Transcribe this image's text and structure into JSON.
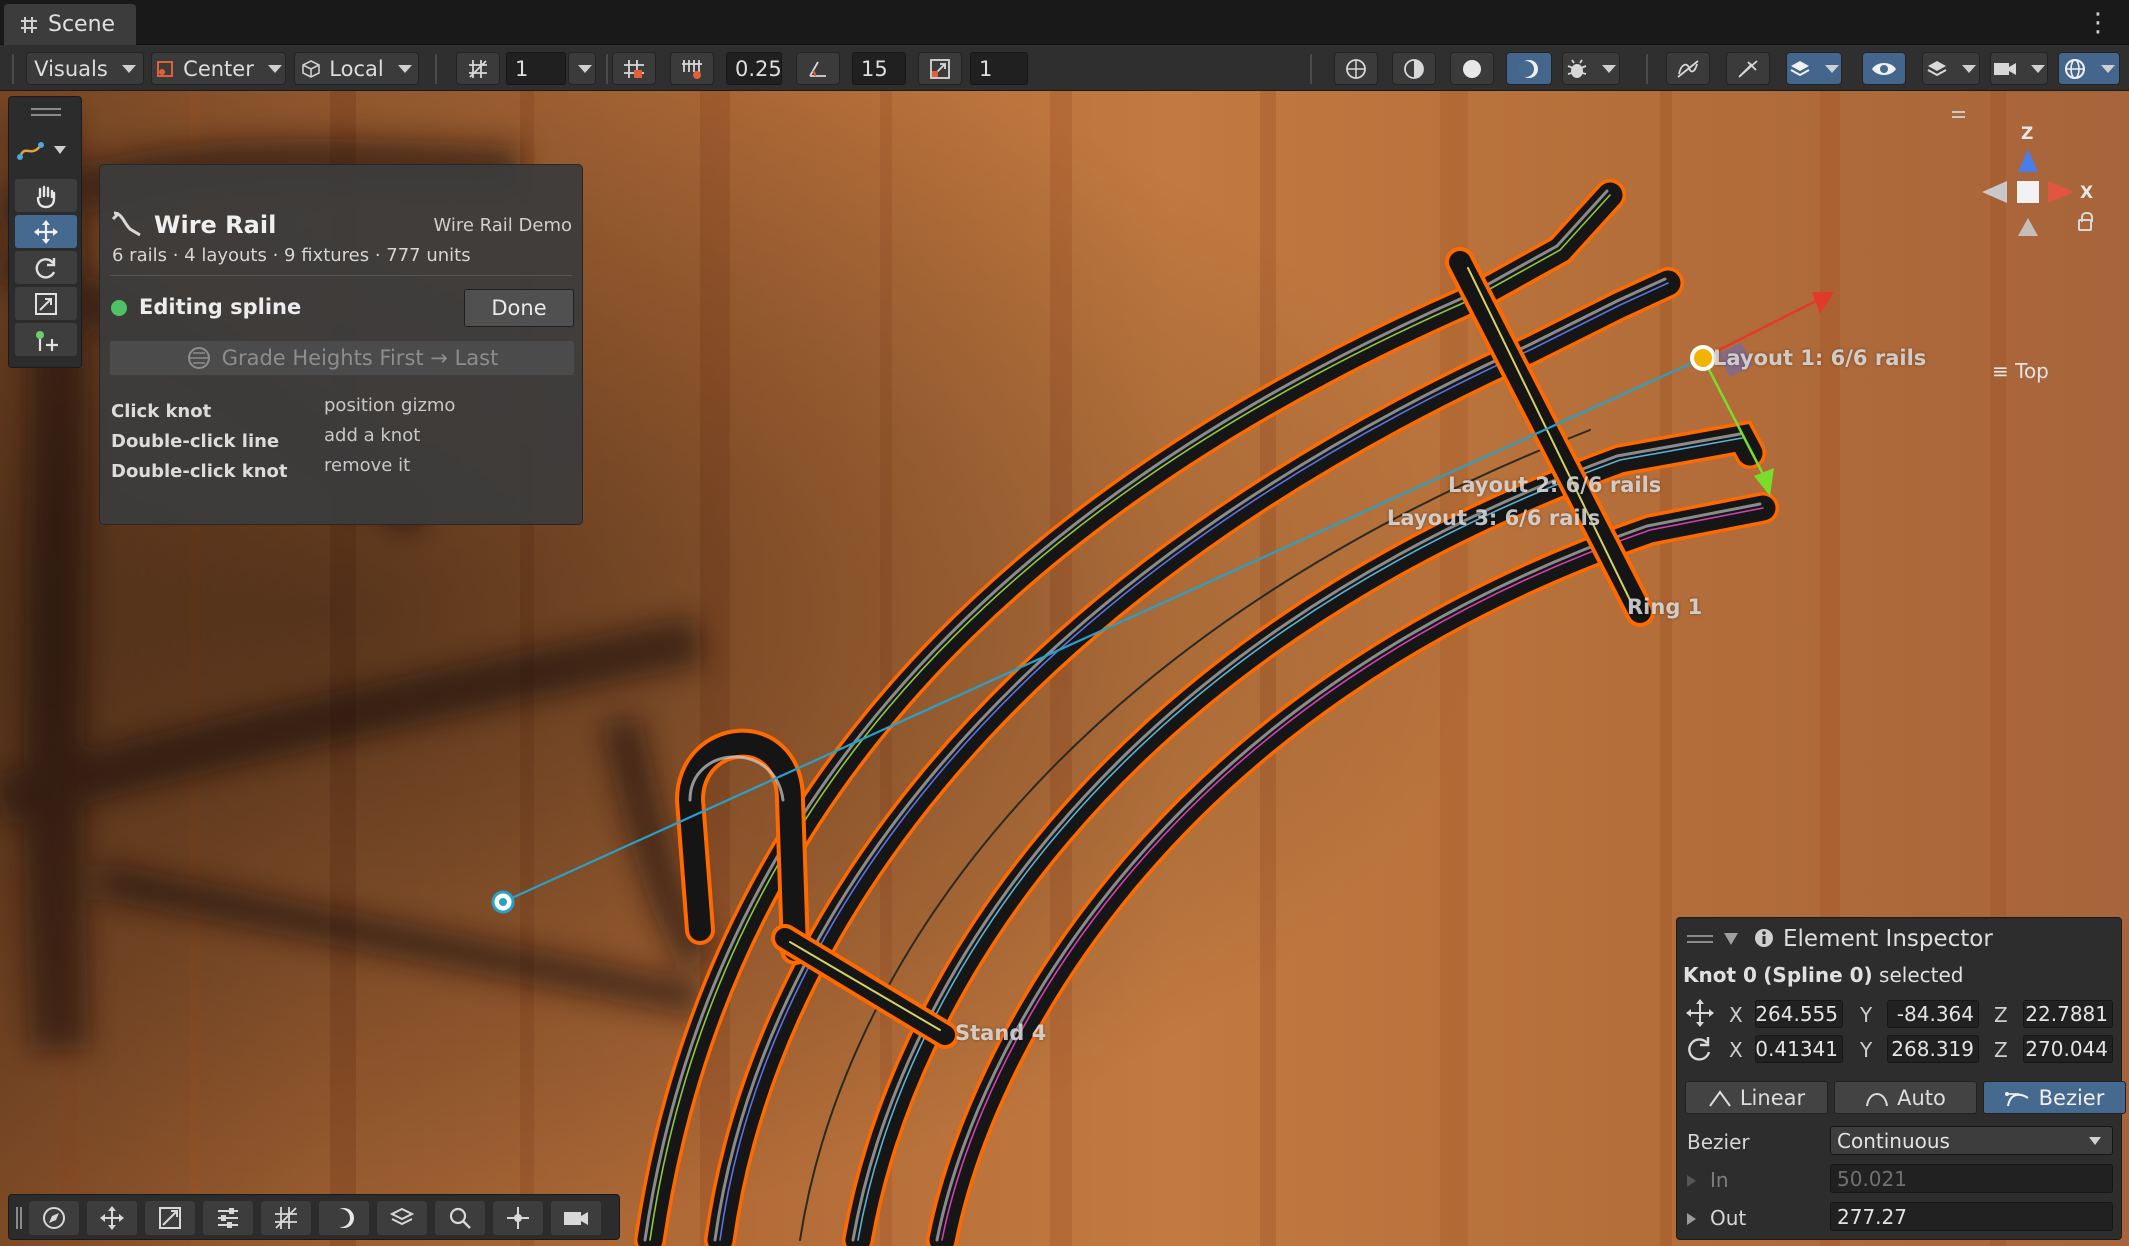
{
  "window": {
    "tab_title": "Scene",
    "menu_icon": "kebab-menu-icon"
  },
  "toolbar": {
    "visuals_label": "Visuals",
    "pivot_label": "Center",
    "space_label": "Local",
    "grid_size": "1",
    "increment_snap": "0.25",
    "rotate_snap": "15",
    "scale_snap": "1"
  },
  "wire_panel": {
    "title": "Wire Rail",
    "demo_name": "Wire Rail Demo",
    "stats": "6 rails · 4 layouts · 9 fixtures · 777 units",
    "status": "Editing spline",
    "done_label": "Done",
    "grade_label": "Grade Heights First → Last",
    "hints": [
      {
        "key": "Click knot",
        "action": "position gizmo"
      },
      {
        "key": "Double-click line",
        "action": "add a knot"
      },
      {
        "key": "Double-click knot",
        "action": "remove it"
      }
    ]
  },
  "scene_labels": {
    "layout1": "Layout 1: 6/6 rails",
    "layout2": "Layout 2: 6/6 rails",
    "layout3": "Layout 3: 6/6 rails",
    "ring": "Ring 1",
    "stand": "Stand 4"
  },
  "orientation_gizmo": {
    "z_axis": "Z",
    "x_axis": "X",
    "view_name": "Top"
  },
  "inspector": {
    "title": "Element Inspector",
    "selection_knot": "Knot 0",
    "selection_spline": "(Spline 0)",
    "selection_suffix": "selected",
    "axis_x": "X",
    "axis_y": "Y",
    "axis_z": "Z",
    "position": {
      "x": "264.555",
      "y": "-84.364",
      "z": "22.7881"
    },
    "rotation": {
      "x": "0.41341",
      "y": "268.319",
      "z": "270.044"
    },
    "tangent_modes": [
      "Linear",
      "Auto",
      "Bezier"
    ],
    "active_mode": "Bezier",
    "bezier_label": "Bezier",
    "bezier_value": "Continuous",
    "in_label": "In",
    "in_value": "50.021",
    "out_label": "Out",
    "out_value": "277.27"
  },
  "colors": {
    "wood": "#b06a34",
    "selection_outline": "#ff6a00",
    "accent_blue": "#46698f",
    "status_green": "#4fc267"
  }
}
